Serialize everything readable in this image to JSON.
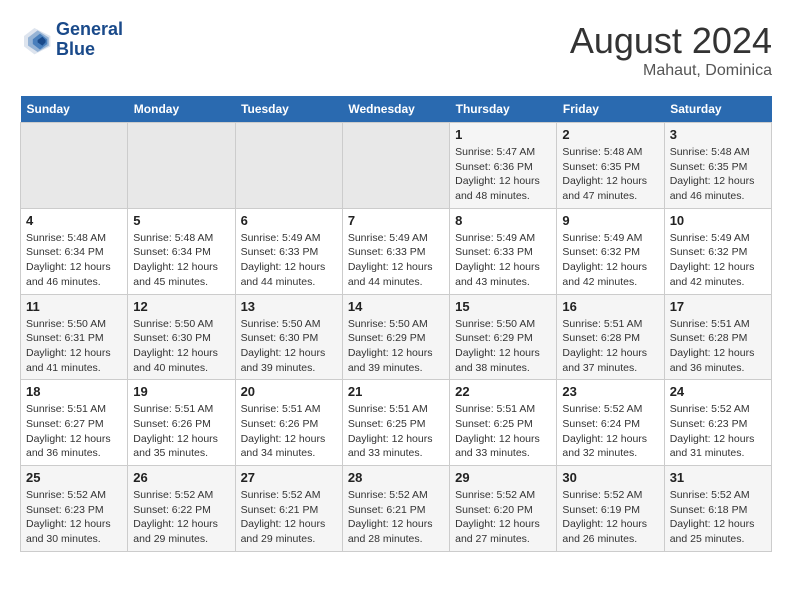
{
  "header": {
    "logo_line1": "General",
    "logo_line2": "Blue",
    "title": "August 2024",
    "subtitle": "Mahaut, Dominica"
  },
  "weekdays": [
    "Sunday",
    "Monday",
    "Tuesday",
    "Wednesday",
    "Thursday",
    "Friday",
    "Saturday"
  ],
  "weeks": [
    [
      {
        "day": "",
        "empty": true
      },
      {
        "day": "",
        "empty": true
      },
      {
        "day": "",
        "empty": true
      },
      {
        "day": "",
        "empty": true
      },
      {
        "day": "1",
        "sunrise": "5:47 AM",
        "sunset": "6:36 PM",
        "daylight": "12 hours and 48 minutes."
      },
      {
        "day": "2",
        "sunrise": "5:48 AM",
        "sunset": "6:35 PM",
        "daylight": "12 hours and 47 minutes."
      },
      {
        "day": "3",
        "sunrise": "5:48 AM",
        "sunset": "6:35 PM",
        "daylight": "12 hours and 46 minutes."
      }
    ],
    [
      {
        "day": "4",
        "sunrise": "5:48 AM",
        "sunset": "6:34 PM",
        "daylight": "12 hours and 46 minutes."
      },
      {
        "day": "5",
        "sunrise": "5:48 AM",
        "sunset": "6:34 PM",
        "daylight": "12 hours and 45 minutes."
      },
      {
        "day": "6",
        "sunrise": "5:49 AM",
        "sunset": "6:33 PM",
        "daylight": "12 hours and 44 minutes."
      },
      {
        "day": "7",
        "sunrise": "5:49 AM",
        "sunset": "6:33 PM",
        "daylight": "12 hours and 44 minutes."
      },
      {
        "day": "8",
        "sunrise": "5:49 AM",
        "sunset": "6:33 PM",
        "daylight": "12 hours and 43 minutes."
      },
      {
        "day": "9",
        "sunrise": "5:49 AM",
        "sunset": "6:32 PM",
        "daylight": "12 hours and 42 minutes."
      },
      {
        "day": "10",
        "sunrise": "5:49 AM",
        "sunset": "6:32 PM",
        "daylight": "12 hours and 42 minutes."
      }
    ],
    [
      {
        "day": "11",
        "sunrise": "5:50 AM",
        "sunset": "6:31 PM",
        "daylight": "12 hours and 41 minutes."
      },
      {
        "day": "12",
        "sunrise": "5:50 AM",
        "sunset": "6:30 PM",
        "daylight": "12 hours and 40 minutes."
      },
      {
        "day": "13",
        "sunrise": "5:50 AM",
        "sunset": "6:30 PM",
        "daylight": "12 hours and 39 minutes."
      },
      {
        "day": "14",
        "sunrise": "5:50 AM",
        "sunset": "6:29 PM",
        "daylight": "12 hours and 39 minutes."
      },
      {
        "day": "15",
        "sunrise": "5:50 AM",
        "sunset": "6:29 PM",
        "daylight": "12 hours and 38 minutes."
      },
      {
        "day": "16",
        "sunrise": "5:51 AM",
        "sunset": "6:28 PM",
        "daylight": "12 hours and 37 minutes."
      },
      {
        "day": "17",
        "sunrise": "5:51 AM",
        "sunset": "6:28 PM",
        "daylight": "12 hours and 36 minutes."
      }
    ],
    [
      {
        "day": "18",
        "sunrise": "5:51 AM",
        "sunset": "6:27 PM",
        "daylight": "12 hours and 36 minutes."
      },
      {
        "day": "19",
        "sunrise": "5:51 AM",
        "sunset": "6:26 PM",
        "daylight": "12 hours and 35 minutes."
      },
      {
        "day": "20",
        "sunrise": "5:51 AM",
        "sunset": "6:26 PM",
        "daylight": "12 hours and 34 minutes."
      },
      {
        "day": "21",
        "sunrise": "5:51 AM",
        "sunset": "6:25 PM",
        "daylight": "12 hours and 33 minutes."
      },
      {
        "day": "22",
        "sunrise": "5:51 AM",
        "sunset": "6:25 PM",
        "daylight": "12 hours and 33 minutes."
      },
      {
        "day": "23",
        "sunrise": "5:52 AM",
        "sunset": "6:24 PM",
        "daylight": "12 hours and 32 minutes."
      },
      {
        "day": "24",
        "sunrise": "5:52 AM",
        "sunset": "6:23 PM",
        "daylight": "12 hours and 31 minutes."
      }
    ],
    [
      {
        "day": "25",
        "sunrise": "5:52 AM",
        "sunset": "6:23 PM",
        "daylight": "12 hours and 30 minutes."
      },
      {
        "day": "26",
        "sunrise": "5:52 AM",
        "sunset": "6:22 PM",
        "daylight": "12 hours and 29 minutes."
      },
      {
        "day": "27",
        "sunrise": "5:52 AM",
        "sunset": "6:21 PM",
        "daylight": "12 hours and 29 minutes."
      },
      {
        "day": "28",
        "sunrise": "5:52 AM",
        "sunset": "6:21 PM",
        "daylight": "12 hours and 28 minutes."
      },
      {
        "day": "29",
        "sunrise": "5:52 AM",
        "sunset": "6:20 PM",
        "daylight": "12 hours and 27 minutes."
      },
      {
        "day": "30",
        "sunrise": "5:52 AM",
        "sunset": "6:19 PM",
        "daylight": "12 hours and 26 minutes."
      },
      {
        "day": "31",
        "sunrise": "5:52 AM",
        "sunset": "6:18 PM",
        "daylight": "12 hours and 25 minutes."
      }
    ]
  ]
}
